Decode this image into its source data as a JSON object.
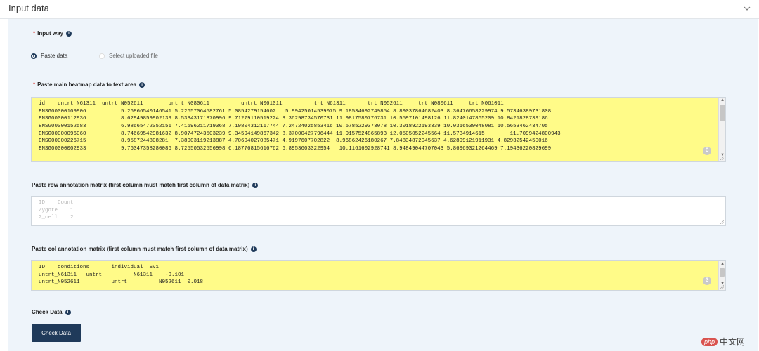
{
  "header": {
    "title": "Input data"
  },
  "input_way": {
    "required_mark": "*",
    "label": "Input way",
    "options": [
      {
        "label": "Paste data",
        "checked": true
      },
      {
        "label": "Select uploaded file",
        "checked": false
      }
    ]
  },
  "main_heatmap": {
    "required_mark": "*",
    "label": "Paste main heatmap data to text area",
    "lines": [
      "id    untrt_N61311  untrt_N052611        untrt_N080611          untrt_N061011          trt_N61311       trt_N052611     trt_N080611     trt_N061011",
      "ENSG00000109906           5.26866540146541 5.22657064582761 5.0854279154602   5.99425014539075 9.18534692749854 8.89037864682403 8.36476658229974 9.57346389731808",
      "ENSG00000112936           8.62949859902139 8.53343171870996 9.71279110519224 8.36298734570731 11.9817580776731 10.5597101498126 11.8240147865209 10.8421828739186",
      "ENSG00000152583           6.98665472052151 7.41596211719368 7.19804312117744 7.24724025853416 10.5785229373078 10.3018922193339 10.0316539048081 10.5653462434705",
      "ENSG00000096060           8.74669542981632 8.90747243503239 9.34594149867342 8.37000427796444 11.9157524865893 12.0505052245564 11.5734914615        11.7099424800943",
      "ENSG00000226715           8.9587244808281  7.38003119213887 4.70604027085471 4.9197607702822  8.96862426180267 7.84834872045637 4.62899121911931 4.82932542450016",
      "ENSG00000002933           9.76347358280086 8.72550532556998 6.18776815616762 6.8953603322954   10.1161602928741 8.94849044707043 5.86969321264469 7.19436220829699"
    ]
  },
  "row_annotation": {
    "label": "Paste row annotation matrix (first column must match first column of data matrix)",
    "lines": [
      "ID    Count",
      "Zygote    1",
      "2_cell    2"
    ]
  },
  "col_annotation": {
    "label": "Paste col annotation matrix (first column must match first column of data matrix)",
    "lines": [
      "ID    conditions       individual  SV1",
      "untrt_N61311   untrt          N61311    -0.101",
      "untrt_N052611          untrt          N052611  0.018"
    ]
  },
  "check_data": {
    "label": "Check Data",
    "button_label": "Check Data"
  },
  "watermark": {
    "badge": "php",
    "text": "中文网"
  },
  "colors": {
    "panel_bg": "#eef4fa",
    "textarea_highlight": "#fffb88",
    "button_bg": "#1f3a5a",
    "required": "#d9534f"
  },
  "icons": [
    "chevron-down-icon",
    "info-icon",
    "grammarly-icon",
    "resize-handle-icon"
  ]
}
